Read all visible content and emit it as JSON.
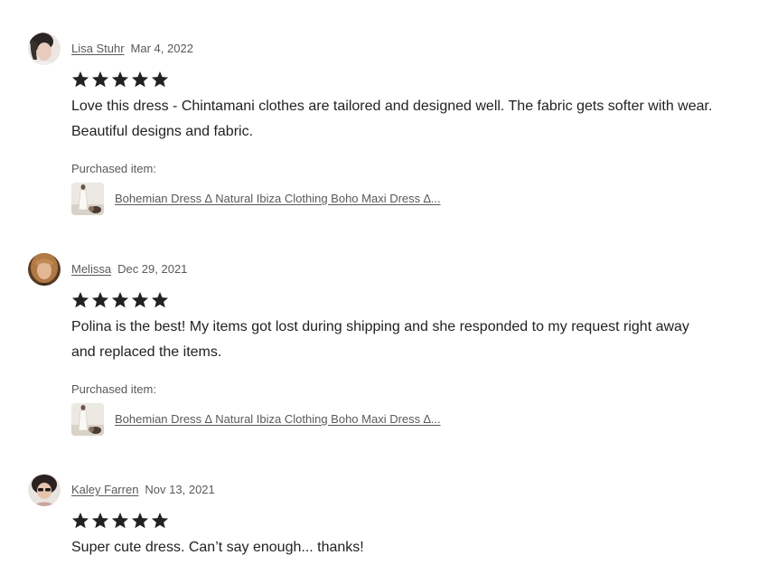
{
  "reviews": [
    {
      "reviewer": "Lisa Stuhr",
      "date": "Mar 4, 2022",
      "rating": 5,
      "text": "Love this dress - Chintamani clothes are tailored and designed well. The fabric gets softer with wear. Beautiful designs and fabric.",
      "purchased_label": "Purchased item:",
      "item_title": "Bohemian Dress ∆ Natural Ibiza Clothing Boho Maxi Dress ∆..."
    },
    {
      "reviewer": "Melissa",
      "date": "Dec 29, 2021",
      "rating": 5,
      "text": "Polina is the best! My items got lost during shipping and she responded to my request right away and replaced the items.",
      "purchased_label": "Purchased item:",
      "item_title": "Bohemian Dress ∆ Natural Ibiza Clothing Boho Maxi Dress ∆..."
    },
    {
      "reviewer": "Kaley Farren",
      "date": "Nov 13, 2021",
      "rating": 5,
      "text": "Super cute dress. Can’t say enough... thanks!"
    }
  ],
  "colors": {
    "text": "#222222",
    "muted": "#595959",
    "star": "#222222"
  },
  "icons": {
    "star": "star-icon",
    "avatar": "avatar",
    "item": "item-thumbnail"
  }
}
